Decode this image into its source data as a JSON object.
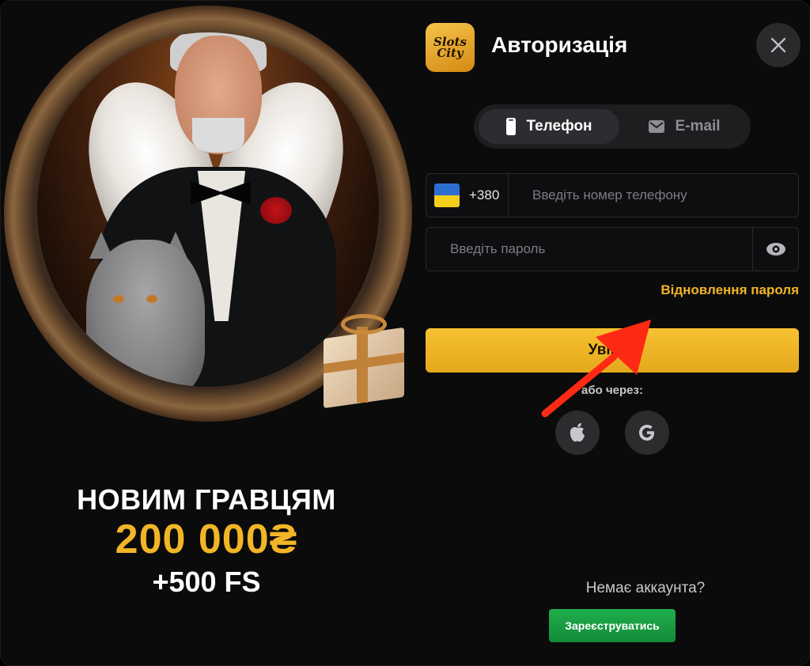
{
  "header": {
    "logo_text": "Slots City",
    "title": "Авторизація"
  },
  "tabs": [
    {
      "label": "Телефон",
      "icon": "phone-icon",
      "active": true
    },
    {
      "label": "E-mail",
      "icon": "mail-icon",
      "active": false
    }
  ],
  "phone_field": {
    "country_code": "+380",
    "flag": "ukraine-flag",
    "placeholder": "Введіть номер телефону",
    "value": ""
  },
  "password_field": {
    "placeholder": "Введіть пароль",
    "value": ""
  },
  "recover_link": "Відновлення пароля",
  "login_button": "Увійти",
  "social": {
    "label": "або через:",
    "providers": [
      "apple-icon",
      "google-icon"
    ]
  },
  "footer": {
    "no_account": "Немає аккаунта?",
    "register_button": "Зареєструватись"
  },
  "promo": {
    "line1": "НОВИМ ГРАВЦЯМ",
    "line2": "200 000₴",
    "line3": "+500 FS"
  },
  "colors": {
    "accent": "#f2b526",
    "register": "#1fae4b",
    "annotation_arrow": "#ff2a14",
    "background": "#0b0b0c"
  }
}
